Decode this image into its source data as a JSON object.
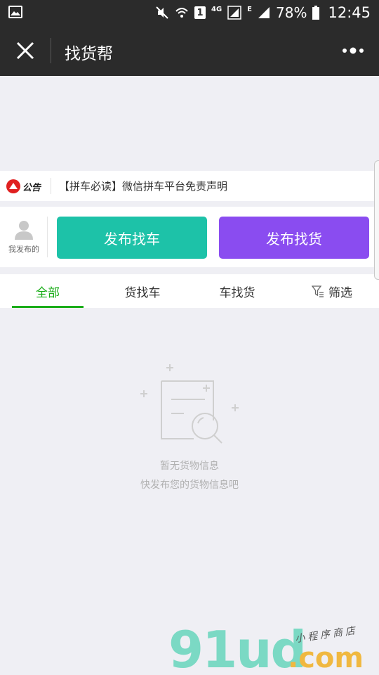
{
  "status_bar": {
    "battery_percent": "78%",
    "time": "12:45",
    "sim_badge": "1",
    "network_4g": "4G",
    "network_e": "E"
  },
  "nav": {
    "title": "找货帮"
  },
  "notice": {
    "badge_text": "公告",
    "text": "【拼车必读】微信拼车平台免责声明"
  },
  "actions": {
    "my_posts_label": "我发布的",
    "find_car_label": "发布找车",
    "find_cargo_label": "发布找货"
  },
  "tabs": [
    {
      "label": "全部",
      "active": true
    },
    {
      "label": "货找车"
    },
    {
      "label": "车找货"
    },
    {
      "label": "筛选"
    }
  ],
  "empty": {
    "line1": "暂无货物信息",
    "line2": "快发布您的货物信息吧"
  },
  "watermark": {
    "brand": "91ud",
    "suffix": ".com",
    "tagline": "小程序商店"
  },
  "colors": {
    "accent_green": "#1aad19",
    "find_car_teal": "#1dc2a8",
    "find_cargo_purple": "#8a4cf0",
    "nav_bg": "#2b2b2b"
  }
}
